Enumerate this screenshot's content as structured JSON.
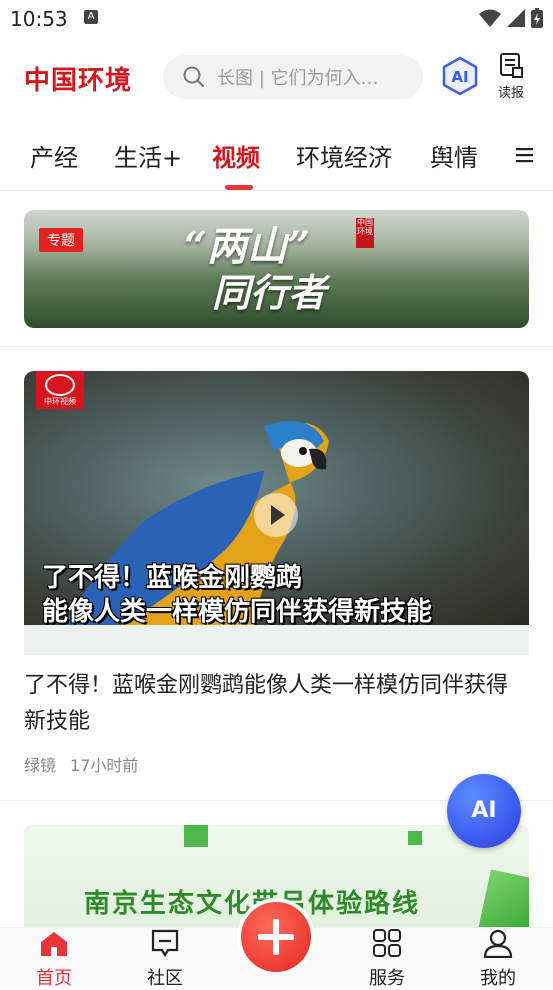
{
  "status_bar": {
    "time": "10:53",
    "notification_badge": "A"
  },
  "header": {
    "logo": "中国环境",
    "search_placeholder": "长图 | 它们为何入…",
    "ai_label": "AI",
    "read_news_label": "读报"
  },
  "tabs": [
    {
      "label": "产经",
      "active": false
    },
    {
      "label": "生活+",
      "active": false
    },
    {
      "label": "视频",
      "active": true
    },
    {
      "label": "环境经济",
      "active": false
    },
    {
      "label": "舆情",
      "active": false
    }
  ],
  "banner": {
    "badge": "专题",
    "title_line1": "“两山”",
    "title_line2": "同行者",
    "stamp": "中国环境"
  },
  "video_card": {
    "logo_text": "中环视频",
    "caption_line1": "了不得！蓝喉金刚鹦鹉",
    "caption_line2": "能像人类一样模仿同伴获得新技能",
    "title": "了不得！蓝喉金刚鹦鹉能像人类一样模仿同伴获得新技能",
    "source": "绿镜",
    "time_ago": "17小时前"
  },
  "next_card": {
    "title": "南京生态文化带吕体验路线"
  },
  "ai_float": {
    "label": "AI"
  },
  "bottom_nav": [
    {
      "label": "首页",
      "icon": "home-icon",
      "active": true
    },
    {
      "label": "社区",
      "icon": "chat-icon",
      "active": false
    },
    {
      "label": "服务",
      "icon": "grid-icon",
      "active": false
    },
    {
      "label": "我的",
      "icon": "user-icon",
      "active": false
    }
  ],
  "colors": {
    "brand": "#d6151d",
    "accent": "#e8353a",
    "ai_blue": "#3d5cf0"
  }
}
